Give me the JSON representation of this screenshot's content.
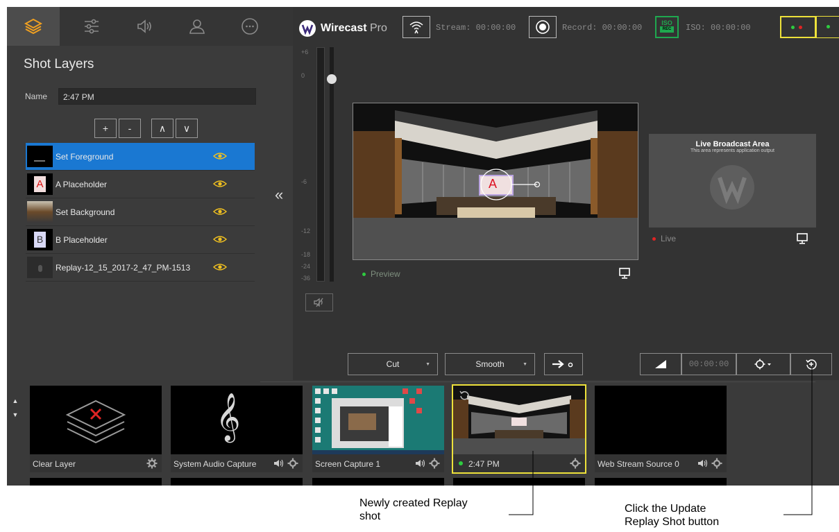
{
  "left_panel": {
    "title": "Shot Layers",
    "name_label": "Name",
    "name_value": "2:47 PM",
    "buttons": {
      "add": "+",
      "remove": "-",
      "up": "∧",
      "down": "∨"
    },
    "collapse": "«",
    "layers": [
      {
        "label": "Set Foreground",
        "selected": true
      },
      {
        "label": "A Placeholder",
        "thumb_letter": "A"
      },
      {
        "label": "Set Background"
      },
      {
        "label": "B Placeholder",
        "thumb_letter": "B"
      },
      {
        "label": "Replay-12_15_2017-2_47_PM-1513"
      }
    ]
  },
  "top_bar": {
    "brand": "Wirecast",
    "brand_suffix": " Pro",
    "stream": "Stream: 00:00:00",
    "record": "Record: 00:00:00",
    "iso_badge_top": "ISO",
    "iso_badge_bottom": "REC",
    "iso": "ISO: 00:00:00"
  },
  "meter": {
    "ticks": [
      "+6",
      "0",
      "-6",
      "-12",
      "-18",
      "-24",
      "-36"
    ]
  },
  "preview": {
    "label": "Preview",
    "placeholder_letter": "A"
  },
  "live": {
    "title": "Live Broadcast Area",
    "subtitle": "This area represents application output",
    "label": "Live"
  },
  "controls": {
    "cut": "Cut",
    "smooth": "Smooth",
    "time": "00:00:00"
  },
  "shots": [
    {
      "name": "Clear Layer"
    },
    {
      "name": "System Audio Capture"
    },
    {
      "name": "Screen Capture 1"
    },
    {
      "name": "2:47 PM",
      "selected": true
    },
    {
      "name": "Web Stream Source 0"
    }
  ],
  "callouts": {
    "replay_line1": "Newly created Replay",
    "replay_line2": "shot",
    "update_line1": "Click the Update",
    "update_line2": "Replay Shot button"
  },
  "colors": {
    "accent_yellow": "#ede13a",
    "selection_blue": "#1a78d2",
    "iso_green": "#1fa84f",
    "tab_orange": "#f0a020"
  }
}
